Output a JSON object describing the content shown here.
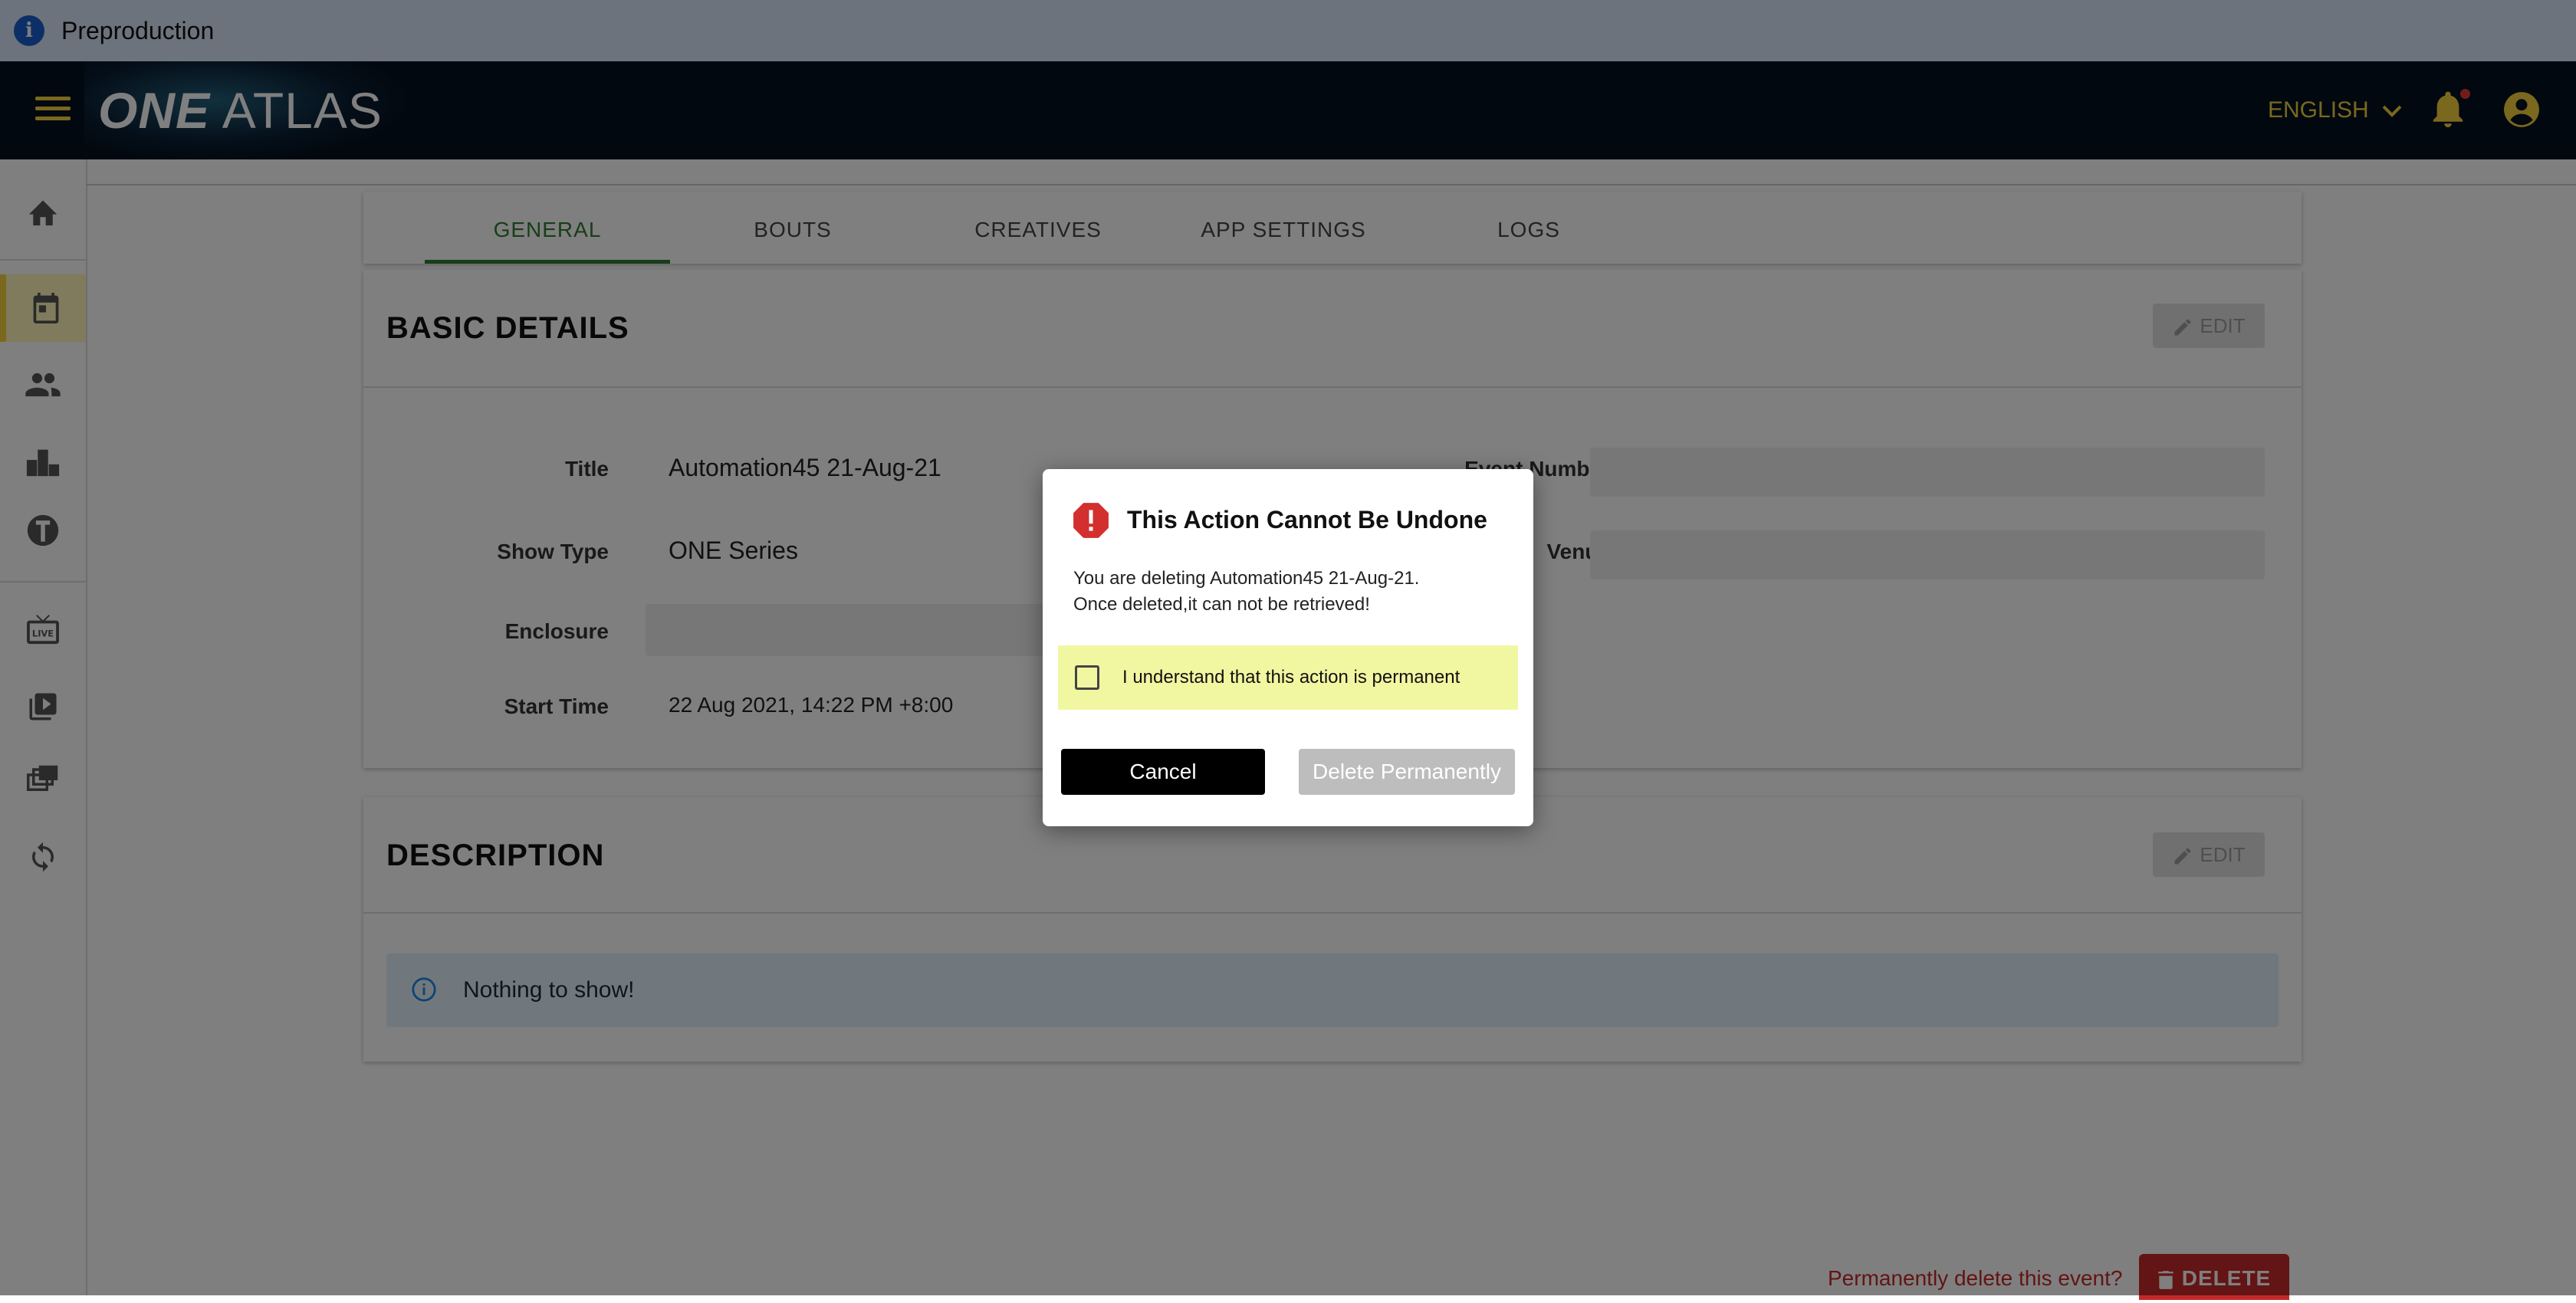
{
  "env": {
    "label": "Preproduction",
    "icon": "info-icon"
  },
  "header": {
    "logo_one": "ONE",
    "logo_atlas": "ATLAS",
    "language": "ENGLISH",
    "accent_color": "#f4d03f",
    "bar_color": "#05101e",
    "has_notification": true
  },
  "sidebar": {
    "items": [
      {
        "icon": "home-icon",
        "active": false
      },
      {
        "icon": "calendar-icon",
        "active": true
      },
      {
        "icon": "people-icon",
        "active": false
      },
      {
        "icon": "podium-icon",
        "active": false
      },
      {
        "icon": "brand-icon",
        "active": false
      },
      {
        "icon": "live-tv-icon",
        "active": false
      },
      {
        "icon": "video-library-icon",
        "active": false
      },
      {
        "icon": "collections-icon",
        "active": false
      },
      {
        "icon": "sync-icon",
        "active": false
      }
    ]
  },
  "tabs": [
    "GENERAL",
    "BOUTS",
    "CREATIVES",
    "APP SETTINGS",
    "LOGS"
  ],
  "basic_details": {
    "title": "BASIC DETAILS",
    "edit_label": "EDIT",
    "fields": {
      "title_label": "Title",
      "title_value": "Automation45 21-Aug-21",
      "show_type_label": "Show Type",
      "show_type_value": "ONE Series",
      "enclosure_label": "Enclosure",
      "start_time_label": "Start Time",
      "start_time_value": "22 Aug 2021, 14:22 PM +8:00",
      "event_number_label": "Event Number",
      "venue_label": "Venue"
    }
  },
  "description": {
    "title": "DESCRIPTION",
    "edit_label": "EDIT",
    "empty_message": "Nothing to show!"
  },
  "footer": {
    "prompt": "Permanently delete this event?",
    "delete_label": "DELETE"
  },
  "dialog": {
    "title": "This Action Cannot Be Undone",
    "message_line1": "You are deleting Automation45 21-Aug-21.",
    "message_line2": "Once deleted,it can not be retrieved!",
    "confirm_text": "I understand that this action is permanent",
    "confirm_checked": false,
    "cancel_label": "Cancel",
    "delete_label": "Delete Permanently",
    "warning_color": "#d32f2f",
    "confirm_bg": "#f1f7a1"
  }
}
